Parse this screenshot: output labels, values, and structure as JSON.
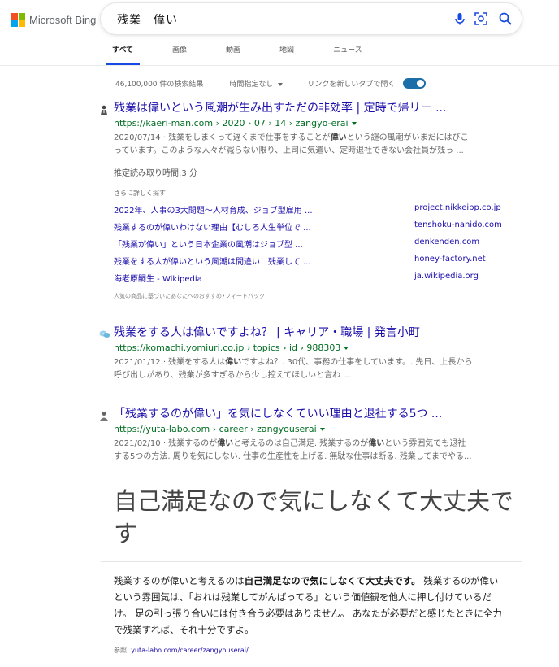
{
  "brand": {
    "name": "Microsoft Bing",
    "colors": [
      "#f25022",
      "#7fba00",
      "#00a4ef",
      "#ffb900"
    ]
  },
  "search": {
    "query": "残業　偉い"
  },
  "icons": {
    "mic": "microphone-icon",
    "camera": "visual-search-icon",
    "search": "search-icon"
  },
  "tabs": [
    {
      "label": "すべて",
      "active": true
    },
    {
      "label": "画像"
    },
    {
      "label": "動画"
    },
    {
      "label": "地図"
    },
    {
      "label": "ニュース"
    }
  ],
  "stats": {
    "count": "46,100,000 件の検索結果",
    "time_filter": "時間指定なし",
    "new_tab_label": "リンクを新しいタブで開く",
    "new_tab_on": true
  },
  "results": [
    {
      "title": "残業は偉いという風潮が生み出すただの非効率 | 定時で帰リー ...",
      "url": "https://kaeri-man.com › 2020 › 07 › 14 › zangyo-erai",
      "snippet_1a": "2020/07/14 · 残業をしまくって遅くまで仕事をすることが",
      "snippet_1b": "偉い",
      "snippet_1c": "という謎の風潮がいまだにはびこ",
      "snippet_2": "っています。このような人々が減らない限り、上司に気遣い、定時退社できない会社員が残っ ...",
      "read_time": "推定読み取り時間:3 分"
    },
    {
      "title": "残業をする人は偉いですよね？ | キャリア・職場 | 発言小町",
      "url": "https://komachi.yomiuri.co.jp › topics › id › 988303",
      "snippet_1a": "2021/01/12 · 残業をする人は",
      "snippet_1b": "偉い",
      "snippet_1c": "ですよね？. 30代、事務の仕事をしています。. 先日、上長から",
      "snippet_2": "呼び出しがあり、残業が多すぎるから少し控えてほしいと言わ ..."
    },
    {
      "title": "「残業するのが偉い」を気にしなくていい理由と退社する5つ ...",
      "url": "https://yuta-labo.com › career › zangyouserai",
      "snippet_1a": "2021/02/10 · 残業するのが",
      "snippet_1b": "偉い",
      "snippet_1c": "と考えるのは自己満足. 残業するのが",
      "snippet_1d": "偉い",
      "snippet_1e": "という雰囲気でも退社",
      "snippet_2": "する5つの方法. 周りを気にしない. 仕事の生産性を上げる. 無駄な仕事は断る. 残業してまでやる..."
    }
  ],
  "more": {
    "title": "さらに詳しく探す",
    "items": [
      {
        "label": "2022年、人事の3大問題～人材育成、ジョブ型雇用 ...",
        "domain": "project.nikkeibp.co.jp"
      },
      {
        "label": "残業するのが偉いわけない理由【むしろ人生単位で ...",
        "domain": "tenshoku-nanido.com"
      },
      {
        "label": "「残業が偉い」という日本企業の風潮はジョブ型 ...",
        "domain": "denkenden.com"
      },
      {
        "label": "残業をする人が偉いという風潮は間違い！残業して ...",
        "domain": "honey-factory.net"
      },
      {
        "label": "海老原嗣生 - Wikipedia",
        "domain": "ja.wikipedia.org"
      }
    ],
    "feedback": "人気の商品に基づいたあなたへのおすすめ•フィードバック"
  },
  "answer": {
    "heading": "自己満足なので気にしなくて大丈夫です",
    "body_a": "残業するのが偉いと考えるのは",
    "body_bold": "自己満足なので気にしなくて大丈夫です。",
    "body_b": " 残業するのが偉いという雰囲気は、「おれは残業してがんばってる」という価値観を他人に押し付けているだけ。 足の引っ張り合いには付き合う必要はありません。 あなたが必要だと感じたときに全力で残業すれば、それ十分ですよ。",
    "ref_label": "参照:",
    "ref_url": "yuta-labo.com/career/zangyouserai/"
  }
}
